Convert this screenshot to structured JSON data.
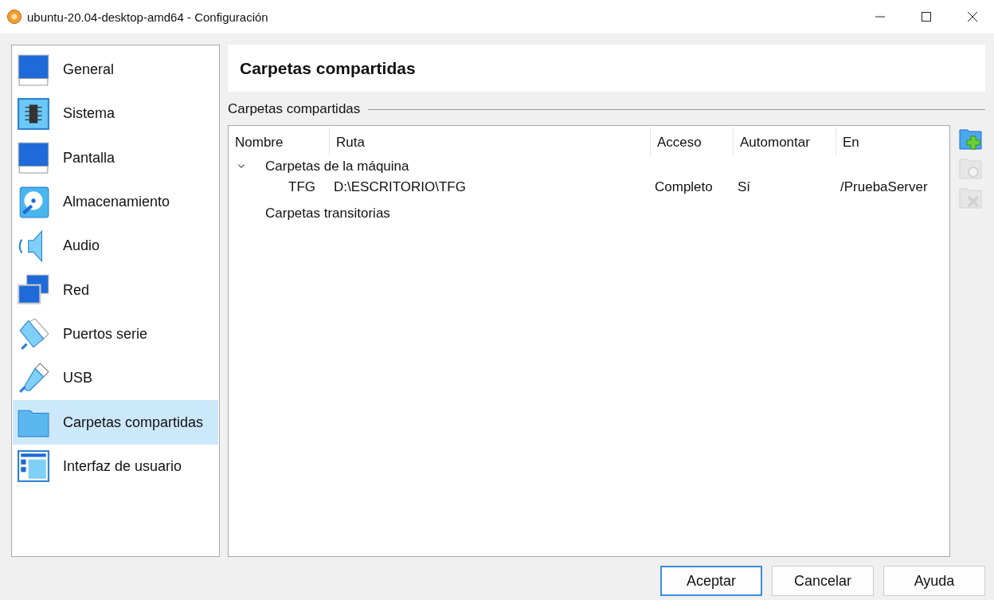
{
  "window": {
    "title": "ubuntu-20.04-desktop-amd64 - Configuración"
  },
  "sidebar": {
    "items": [
      {
        "label": "General",
        "kind": "monitor",
        "selected": false
      },
      {
        "label": "Sistema",
        "kind": "chip",
        "selected": false
      },
      {
        "label": "Pantalla",
        "kind": "monitor",
        "selected": false
      },
      {
        "label": "Almacenamiento",
        "kind": "disk",
        "selected": false
      },
      {
        "label": "Audio",
        "kind": "speaker",
        "selected": false
      },
      {
        "label": "Red",
        "kind": "network",
        "selected": false
      },
      {
        "label": "Puertos serie",
        "kind": "serial",
        "selected": false
      },
      {
        "label": "USB",
        "kind": "usb",
        "selected": false
      },
      {
        "label": "Carpetas compartidas",
        "kind": "folder",
        "selected": true
      },
      {
        "label": "Interfaz de usuario",
        "kind": "window",
        "selected": false
      }
    ]
  },
  "page": {
    "title": "Carpetas compartidas",
    "group_label": "Carpetas compartidas"
  },
  "table": {
    "columns": [
      "Nombre",
      "Ruta",
      "Acceso",
      "Automontar",
      "En"
    ],
    "groups": [
      {
        "label": "Carpetas de la máquina",
        "expanded": true,
        "rows": [
          {
            "cells": [
              "TFG",
              "D:\\ESCRITORIO\\TFG",
              "Completo",
              "Sí",
              "/PruebaServer"
            ]
          }
        ]
      },
      {
        "label": "Carpetas transitorias"
      }
    ]
  },
  "toolbar": [
    {
      "kind": "add",
      "disabled": false
    },
    {
      "kind": "edit",
      "disabled": true
    },
    {
      "kind": "remove",
      "disabled": true
    }
  ],
  "buttons": [
    {
      "label": "Aceptar",
      "default": true
    },
    {
      "label": "Cancelar",
      "default": false
    },
    {
      "label": "Ayuda",
      "default": false
    }
  ]
}
